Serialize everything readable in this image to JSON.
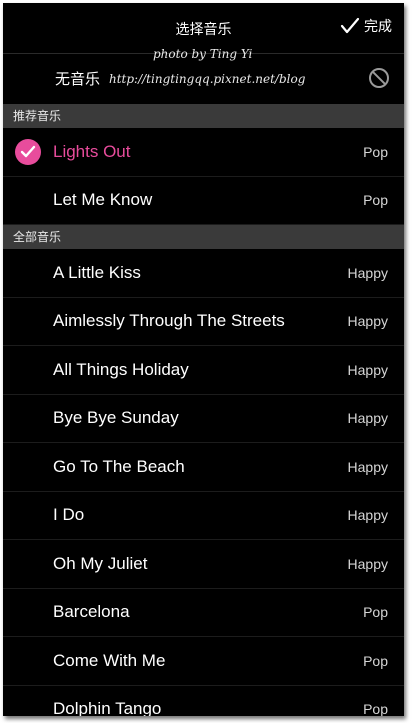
{
  "header": {
    "title": "选择音乐",
    "done_label": "完成"
  },
  "watermark": {
    "line1": "photo by Ting Yi",
    "line2": "http://tingtingqq.pixnet.net/blog"
  },
  "no_music": {
    "label": "无音乐",
    "icon": "prohibited-icon"
  },
  "sections": {
    "recommended": {
      "header": "推荐音乐",
      "songs": [
        {
          "title": "Lights Out",
          "genre": "Pop",
          "selected": true
        },
        {
          "title": "Let Me Know",
          "genre": "Pop",
          "selected": false
        }
      ]
    },
    "all": {
      "header": "全部音乐",
      "songs": [
        {
          "title": "A Little Kiss",
          "genre": "Happy"
        },
        {
          "title": "Aimlessly Through The Streets",
          "genre": "Happy"
        },
        {
          "title": "All Things Holiday",
          "genre": "Happy"
        },
        {
          "title": "Bye Bye Sunday",
          "genre": "Happy"
        },
        {
          "title": "Go To The Beach",
          "genre": "Happy"
        },
        {
          "title": "I Do",
          "genre": "Happy"
        },
        {
          "title": "Oh My Juliet",
          "genre": "Happy"
        },
        {
          "title": "Barcelona",
          "genre": "Pop"
        },
        {
          "title": "Come With Me",
          "genre": "Pop"
        },
        {
          "title": "Dolphin Tango",
          "genre": "Pop"
        }
      ]
    }
  },
  "colors": {
    "accent": "#e84c9c",
    "background": "#000000",
    "section_header": "#3a3a3a"
  }
}
